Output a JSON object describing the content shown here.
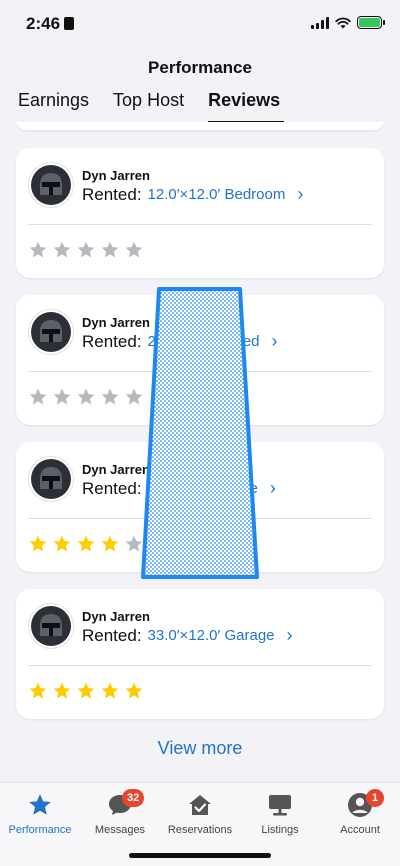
{
  "status": {
    "time": "2:46"
  },
  "header": {
    "title": "Performance"
  },
  "tabs": [
    {
      "label": "Earnings",
      "active": false
    },
    {
      "label": "Top Host",
      "active": false
    },
    {
      "label": "Reviews",
      "active": true
    }
  ],
  "reviews": [
    {
      "name": "Dyn Jarren",
      "rented_label": "Rented:",
      "listing": "12.0′×12.0′ Bedroom",
      "rating": 0
    },
    {
      "name": "Dyn Jarren",
      "rented_label": "Rented:",
      "listing": "20.0′×20.0′ Shed",
      "rating": 0
    },
    {
      "name": "Dyn Jarren",
      "rented_label": "Rented:",
      "listing": "5.0′×5.0′ Garage",
      "rating": 4
    },
    {
      "name": "Dyn Jarren",
      "rented_label": "Rented:",
      "listing": "33.0′×12.0′ Garage",
      "rating": 5
    }
  ],
  "view_more": "View more",
  "tabbar": [
    {
      "label": "Performance",
      "icon": "star-icon",
      "active": true
    },
    {
      "label": "Messages",
      "icon": "chat-bubble-icon",
      "badge": "32"
    },
    {
      "label": "Reservations",
      "icon": "house-check-icon"
    },
    {
      "label": "Listings",
      "icon": "listing-sign-icon"
    },
    {
      "label": "Account",
      "icon": "person-icon",
      "badge": "1"
    }
  ],
  "colors": {
    "accent": "#1f74c9",
    "star_filled": "#ffcc00",
    "star_empty": "#b7b9c0",
    "badge": "#e8452f",
    "overlay": "#1e88f0"
  }
}
